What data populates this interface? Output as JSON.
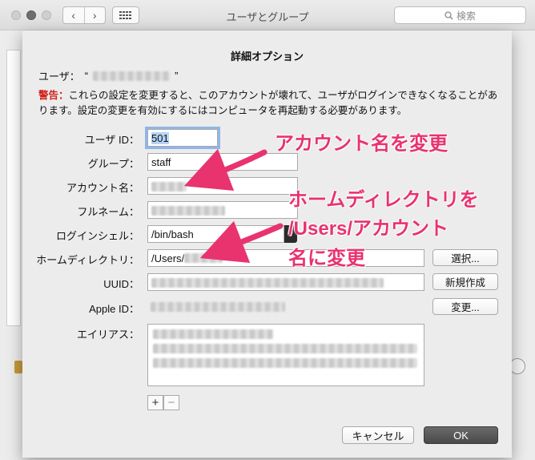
{
  "window": {
    "title": "ユーザとグループ",
    "search_placeholder": "検索",
    "nav_back": "‹",
    "nav_forward": "›"
  },
  "sheet": {
    "title": "詳細オプション",
    "user_label": "ユーザ：",
    "user_open_quote": "“",
    "user_close_quote": "”",
    "warning_label": "警告：",
    "warning_text": "これらの設定を変更すると、このアカウントが壊れて、ユーザがログインできなくなることがあります。設定の変更を有効にするにはコンピュータを再起動する必要があります。",
    "fields": {
      "user_id": {
        "label": "ユーザ ID：",
        "value": "501"
      },
      "group": {
        "label": "グループ：",
        "value": "staff"
      },
      "account_name": {
        "label": "アカウント名：",
        "value": ""
      },
      "full_name": {
        "label": "フルネーム：",
        "value": ""
      },
      "login_shell": {
        "label": "ログインシェル：",
        "value": "/bin/bash"
      },
      "home_directory": {
        "label": "ホームディレクトリ：",
        "value": "/Users/"
      },
      "uuid": {
        "label": "UUID：",
        "value": ""
      },
      "apple_id": {
        "label": "Apple ID：",
        "value": ""
      },
      "aliases": {
        "label": "エイリアス："
      }
    },
    "buttons": {
      "choose": "選択...",
      "create_new": "新規作成",
      "change": "変更...",
      "add": "+",
      "remove": "−",
      "cancel": "キャンセル",
      "ok": "OK"
    }
  },
  "annotations": {
    "account_name_note": "アカウント名を変更",
    "home_dir_note_line1": "ホームディレクトリを",
    "home_dir_note_line2": "/Users/アカウント",
    "home_dir_note_line3": "名に変更",
    "color": "#e8336f"
  }
}
